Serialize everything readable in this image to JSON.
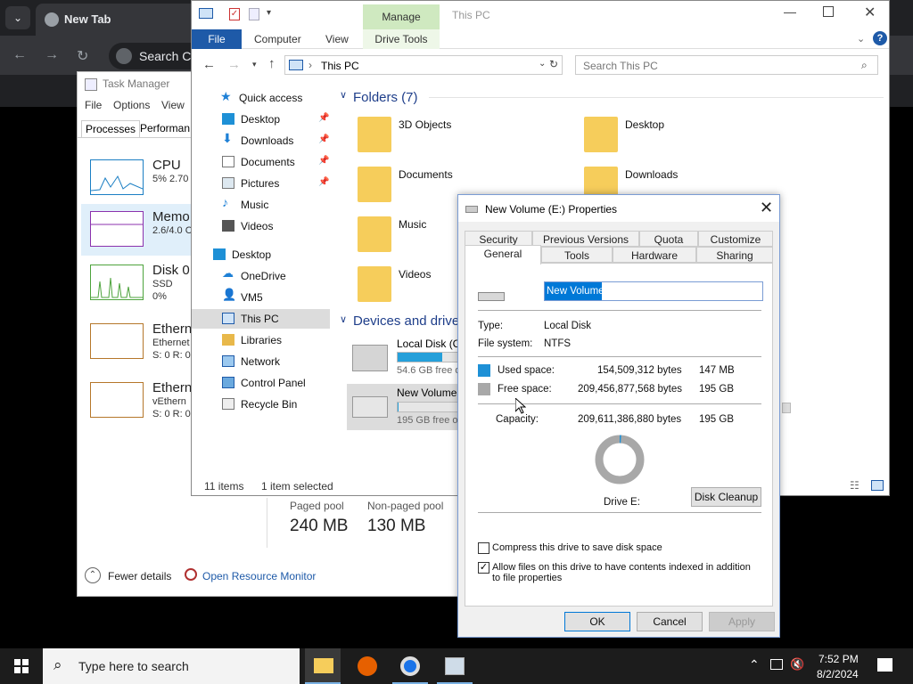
{
  "chrome": {
    "tab_title": "New Tab",
    "omnibox_text": "Search Co"
  },
  "taskmgr": {
    "title": "Task Manager",
    "menu": [
      "File",
      "Options",
      "View"
    ],
    "tabs": [
      "Processes",
      "Performan"
    ],
    "items": [
      {
        "name": "CPU",
        "sub1": "5% 2.70",
        "sub2": ""
      },
      {
        "name": "Memo",
        "sub1": "2.6/4.0 C",
        "sub2": ""
      },
      {
        "name": "Disk 0",
        "sub1": "SSD",
        "sub2": "0%"
      },
      {
        "name": "Ethern",
        "sub1": "Ethernet",
        "sub2": "S: 0 R: 0"
      },
      {
        "name": "Ethern",
        "sub1": "vEthern",
        "sub2": "S: 0 R: 0"
      }
    ],
    "paged_pool_label": "Paged pool",
    "paged_pool_value": "240 MB",
    "nonpaged_pool_label": "Non-paged pool",
    "nonpaged_pool_value": "130 MB",
    "fewer_details": "Fewer details",
    "open_resource_monitor": "Open Resource Monitor"
  },
  "explorer": {
    "title": "This PC",
    "manage": "Manage",
    "ribbon_tabs": [
      "File",
      "Computer",
      "View",
      "Drive Tools"
    ],
    "address": "This PC",
    "search_placeholder": "Search This PC",
    "nav": {
      "quick_access": "Quick access",
      "items": [
        {
          "label": "Desktop",
          "pinned": true
        },
        {
          "label": "Downloads",
          "pinned": true
        },
        {
          "label": "Documents",
          "pinned": true
        },
        {
          "label": "Pictures",
          "pinned": true
        },
        {
          "label": "Music",
          "pinned": false
        },
        {
          "label": "Videos",
          "pinned": false
        }
      ],
      "desktop": "Desktop",
      "sub": [
        "OneDrive",
        "VM5",
        "This PC",
        "Libraries",
        "Network",
        "Control Panel",
        "Recycle Bin"
      ]
    },
    "folders_header": "Folders (7)",
    "folders": [
      "3D Objects",
      "Desktop",
      "Documents",
      "Downloads",
      "Music",
      "Videos"
    ],
    "devices_header": "Devices and drives",
    "drives": [
      {
        "name": "Local Disk (C",
        "free": "54.6 GB free o",
        "used_fraction": 0.73
      },
      {
        "name": "New Volume",
        "free": "195 GB free o",
        "used_fraction": 0.01
      }
    ],
    "status_items": "11 items",
    "status_selected": "1 item selected"
  },
  "props": {
    "title": "New Volume (E:) Properties",
    "tabs_row1": [
      "Security",
      "Previous Versions",
      "Quota",
      "Customize"
    ],
    "tabs_row2": [
      "General",
      "Tools",
      "Hardware",
      "Sharing"
    ],
    "volume_name": "New Volume",
    "type_label": "Type:",
    "type_value": "Local Disk",
    "fs_label": "File system:",
    "fs_value": "NTFS",
    "used_label": "Used space:",
    "used_bytes": "154,509,312 bytes",
    "used_size": "147 MB",
    "free_label": "Free space:",
    "free_bytes": "209,456,877,568 bytes",
    "free_size": "195 GB",
    "capacity_label": "Capacity:",
    "capacity_bytes": "209,611,386,880 bytes",
    "capacity_size": "195 GB",
    "drive_label": "Drive E:",
    "disk_cleanup": "Disk Cleanup",
    "compress_label": "Compress this drive to save disk space",
    "index_label": "Allow files on this drive to have contents indexed in addition to file properties",
    "ok": "OK",
    "cancel": "Cancel",
    "apply": "Apply",
    "used_color": "#1e90d6",
    "free_color": "#a8a8a8"
  },
  "taskbar": {
    "search_placeholder": "Type here to search",
    "time": "7:52 PM",
    "date": "8/2/2024"
  }
}
